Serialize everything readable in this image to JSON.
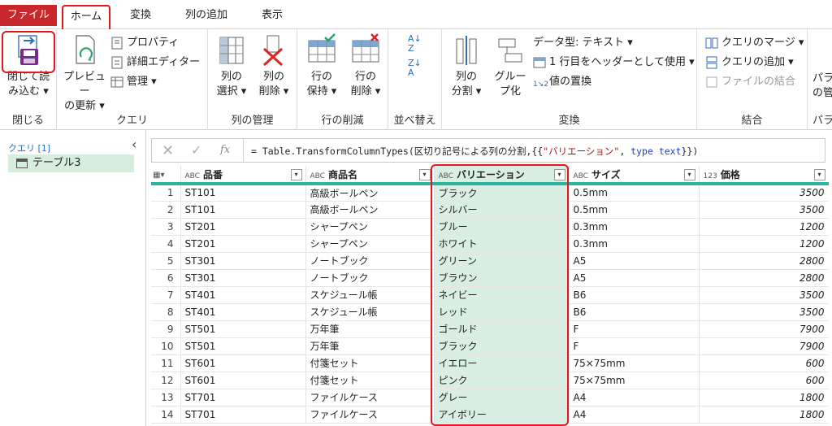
{
  "tabs": [
    "ファイル",
    "ホーム",
    "変換",
    "列の追加",
    "表示"
  ],
  "ribbon": {
    "close": {
      "label1": "閉じて読",
      "label2": "み込む",
      "group": "閉じる"
    },
    "query": {
      "preview1": "プレビュー",
      "preview2": "の更新",
      "properties": "プロパティ",
      "advanced_editor": "詳細エディター",
      "manage": "管理",
      "group": "クエリ"
    },
    "columns": {
      "select1": "列の",
      "select2": "選択",
      "remove1": "列の",
      "remove2": "削除",
      "group": "列の管理"
    },
    "rows": {
      "keep1": "行の",
      "keep2": "保持",
      "remove1": "行の",
      "remove2": "削除",
      "group": "行の削減"
    },
    "sort": {
      "group": "並べ替え"
    },
    "transform": {
      "split1": "列の",
      "split2": "分割",
      "group1": "グルー",
      "group2": "プ化",
      "datatype": "データ型: テキスト",
      "first_row_header": "1 行目をヘッダーとして使用",
      "replace_values": "値の置換",
      "group": "変換"
    },
    "combine": {
      "merge": "クエリのマージ",
      "append": "クエリの追加",
      "combine_files": "ファイルの結合",
      "group": "結合"
    },
    "params": {
      "label": "パラ",
      "label2": "の管",
      "group": "パラ"
    }
  },
  "queries": {
    "header": "クエリ [1]",
    "items": [
      "テーブル3"
    ]
  },
  "formula": {
    "prefix": "= Table.TransformColumnTypes(区切り記号による列の分割,{{",
    "str": "\"バリエーション\"",
    "mid": ", ",
    "kw": "type text",
    "suffix": "}})"
  },
  "table": {
    "columns": [
      {
        "name": "品番",
        "type": "ABC"
      },
      {
        "name": "商品名",
        "type": "ABC"
      },
      {
        "name": "バリエーション",
        "type": "ABC"
      },
      {
        "name": "サイズ",
        "type": "ABC"
      },
      {
        "name": "価格",
        "type": "123"
      }
    ],
    "rows": [
      [
        "1",
        "ST101",
        "高級ボールペン",
        "ブラック",
        "0.5mm",
        "3500"
      ],
      [
        "2",
        "ST101",
        "高級ボールペン",
        "シルバー",
        "0.5mm",
        "3500"
      ],
      [
        "3",
        "ST201",
        "シャープペン",
        "ブルー",
        "0.3mm",
        "1200"
      ],
      [
        "4",
        "ST201",
        "シャープペン",
        "ホワイト",
        "0.3mm",
        "1200"
      ],
      [
        "5",
        "ST301",
        "ノートブック",
        "グリーン",
        "A5",
        "2800"
      ],
      [
        "6",
        "ST301",
        "ノートブック",
        "ブラウン",
        "A5",
        "2800"
      ],
      [
        "7",
        "ST401",
        "スケジュール帳",
        "ネイビー",
        "B6",
        "3500"
      ],
      [
        "8",
        "ST401",
        "スケジュール帳",
        "レッド",
        "B6",
        "3500"
      ],
      [
        "9",
        "ST501",
        "万年筆",
        "ゴールド",
        "F",
        "7900"
      ],
      [
        "10",
        "ST501",
        "万年筆",
        "ブラック",
        "F",
        "7900"
      ],
      [
        "11",
        "ST601",
        "付箋セット",
        "イエロー",
        "75×75mm",
        "600"
      ],
      [
        "12",
        "ST601",
        "付箋セット",
        "ピンク",
        "75×75mm",
        "600"
      ],
      [
        "13",
        "ST701",
        "ファイルケース",
        "グレー",
        "A4",
        "1800"
      ],
      [
        "14",
        "ST701",
        "ファイルケース",
        "アイボリー",
        "A4",
        "1800"
      ]
    ]
  }
}
